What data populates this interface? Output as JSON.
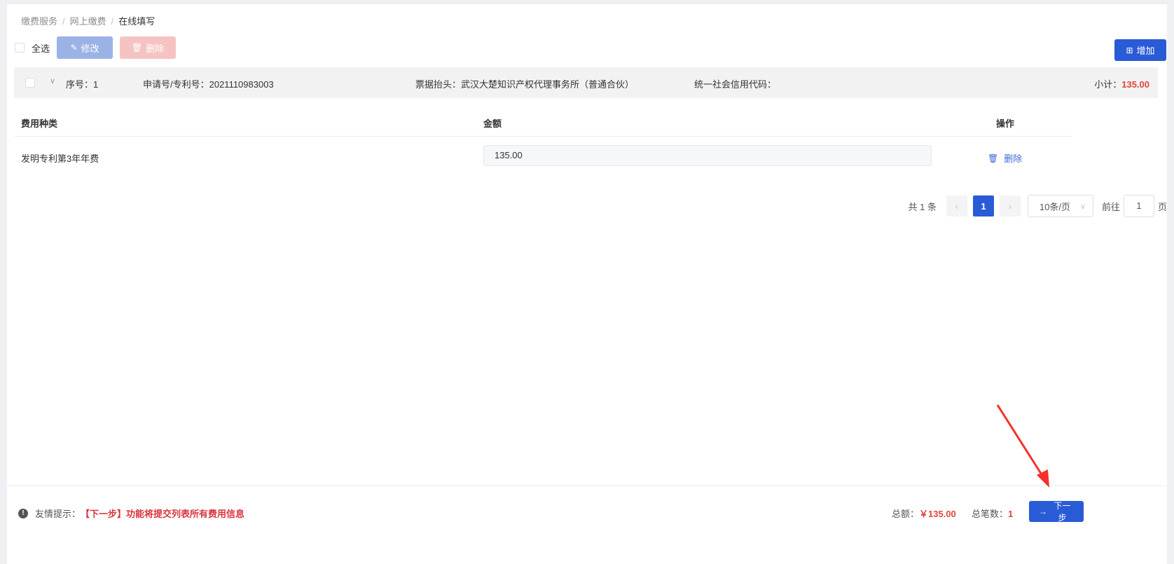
{
  "breadcrumb": {
    "items": [
      "缴费服务",
      "网上缴费",
      "在线填写"
    ],
    "separator": "/"
  },
  "toolbar": {
    "select_all_label": "全选",
    "edit_label": "修改",
    "delete_label": "删除",
    "add_label": "增加"
  },
  "group": {
    "seq": "序号：1",
    "app_no": "申请号/专利号：2021110983003",
    "invoice_title": "票据抬头：武汉大楚知识产权代理事务所（普通合伙）",
    "credit_code": "统一社会信用代码：",
    "subtotal_label": "小计：",
    "subtotal_value": "135.00"
  },
  "table": {
    "columns": [
      "费用种类",
      "金额",
      "操作"
    ],
    "rows": [
      {
        "fee_type": "发明专利第3年年费",
        "amount": "135.00",
        "action": "删除"
      }
    ]
  },
  "pagination": {
    "total": "共 1 条",
    "prev": "‹",
    "current": "1",
    "next": "›",
    "page_size": "10条/页",
    "goto": "前往",
    "goto_value": "1",
    "page_unit": "页"
  },
  "footer": {
    "tip_label": "友情提示：",
    "tip_message": "【下一步】功能将提交列表所有费用信息",
    "total_label": "总额：",
    "total_value": "￥135.00",
    "count_label": "总笔数：",
    "count_value": "1",
    "next_label": "下一步"
  },
  "colors": {
    "primary": "#2a5bd7",
    "danger": "#e0463e",
    "annotation_arrow": "#f5302a"
  }
}
